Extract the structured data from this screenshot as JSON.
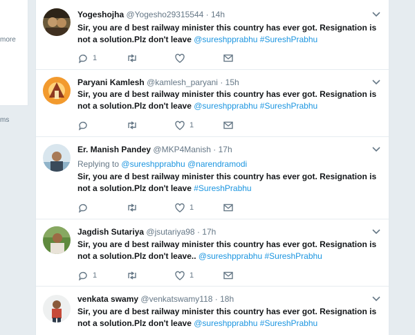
{
  "sidebar": {
    "more_label": "more",
    "terms_fragment": "ms"
  },
  "tweets": [
    {
      "name": "Yogeshojha",
      "handle": "@Yogesho29315544",
      "time": "14h",
      "reply_to": null,
      "text": "Sir, you are d best railway minister this country has ever got. Resignation is not a solution.Plz don't leave",
      "links": "@sureshpprabhu #SureshPrabhu",
      "reply_count": "1",
      "retweet_count": "",
      "like_count": ""
    },
    {
      "name": "Paryani Kamlesh",
      "handle": "@kamlesh_paryani",
      "time": "15h",
      "reply_to": null,
      "text": "Sir, you are d best railway minister this country has ever got. Resignation is not a solution.Plz don't leave",
      "links": "@sureshpprabhu #SureshPrabhu",
      "reply_count": "",
      "retweet_count": "",
      "like_count": "1"
    },
    {
      "name": "Er. Manish Pandey",
      "handle": "@MKP4Manish",
      "time": "17h",
      "reply_to": {
        "prefix": "Replying to",
        "users": "@sureshpprabhu @narendramodi"
      },
      "text": "Sir, you are d best railway minister this country has ever got. Resignation is not a solution.Plz don't leave",
      "links": "#SureshPrabhu",
      "reply_count": "",
      "retweet_count": "",
      "like_count": "1"
    },
    {
      "name": "Jagdish Sutariya",
      "handle": "@jsutariya98",
      "time": "17h",
      "reply_to": null,
      "text": "Sir, you are d best railway minister this country has ever got. Resignation is not a solution.Plz don't leave..",
      "links": "@sureshpprabhu #SureshPrabhu",
      "reply_count": "1",
      "retweet_count": "",
      "like_count": "1"
    },
    {
      "name": "venkata swamy",
      "handle": "@venkatswamy118",
      "time": "18h",
      "reply_to": null,
      "text": "Sir, you are d best railway minister this country has ever got. Resignation is not a solution.Plz don't leave",
      "links": "@sureshpprabhu #SureshPrabhu",
      "reply_count": "",
      "retweet_count": "",
      "like_count": ""
    }
  ],
  "icons": {
    "reply": "reply-icon",
    "retweet": "retweet-icon",
    "like": "heart-icon",
    "message": "envelope-icon",
    "caret": "chevron-down-icon"
  },
  "colors": {
    "link": "#1b95e0",
    "meta": "#657786",
    "text": "#14171a",
    "bg": "#e6ecf0"
  }
}
